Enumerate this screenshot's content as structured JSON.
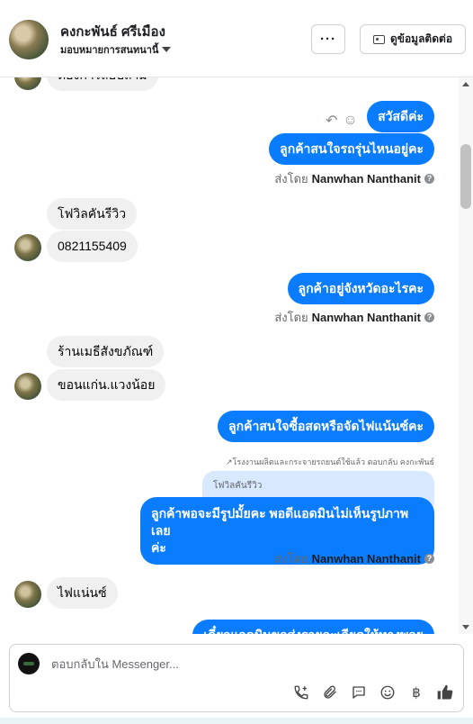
{
  "header": {
    "name": "คงกะพันธ์ ศรีเมือง",
    "assign_label": "มอบหมายการสนทนานี้",
    "more_label": "···",
    "contact_label": "ดูข้อมูลติดต่อ"
  },
  "messages": {
    "partial_top": "ต้องการสอบถาม",
    "m1": "สวัสดีค่ะ",
    "m2": "ลูกค้าสนใจรถรุ่นไหนอยู่คะ",
    "sent_prefix": "ส่งโดย",
    "sender": "Nanwhan Nanthanit",
    "i1": "โฟวิลคันรีวิว",
    "i2": "0821155409",
    "m3": "ลูกค้าอยู่จังหวัดอะไรคะ",
    "i3": "ร้านเมธีสังขภัณฑ์",
    "i4": "ขอนแก่น.แวงน้อย",
    "m4": "ลูกค้าสนใจซื้อสดหรือจัดไฟแน้นซ์คะ",
    "reply_note": "↗โรงงานผลิตและกระจายรถยนต์ใช้แล้ว ตอบกลับ คงกะพันธ์",
    "quoted": "โฟวิลคันรีวิว",
    "m5_line1": "ลูกค้าพอจะมีรูปมั้ยคะ พอดีแอดมินไม่เห็นรูปภาพเลย",
    "m5_line2": "ค่ะ",
    "i5": "ไฟแน่นซ์",
    "partial_bottom": "เดี๋ยวแอดมินขอส่งรายละเอียดให้ทางพอย"
  },
  "composer": {
    "placeholder": "ตอบกลับใน Messenger..."
  },
  "icons": {
    "reply": "reply-icon",
    "emoji": "smile-icon",
    "call": "call-add-icon",
    "attach": "paperclip-icon",
    "saved": "saved-reply-icon",
    "emoji2": "emoji-icon",
    "currency": "baht-icon",
    "like": "thumbs-up-icon"
  },
  "colors": {
    "outgoing": "#0a7cff",
    "incoming": "#f0f0f0"
  }
}
